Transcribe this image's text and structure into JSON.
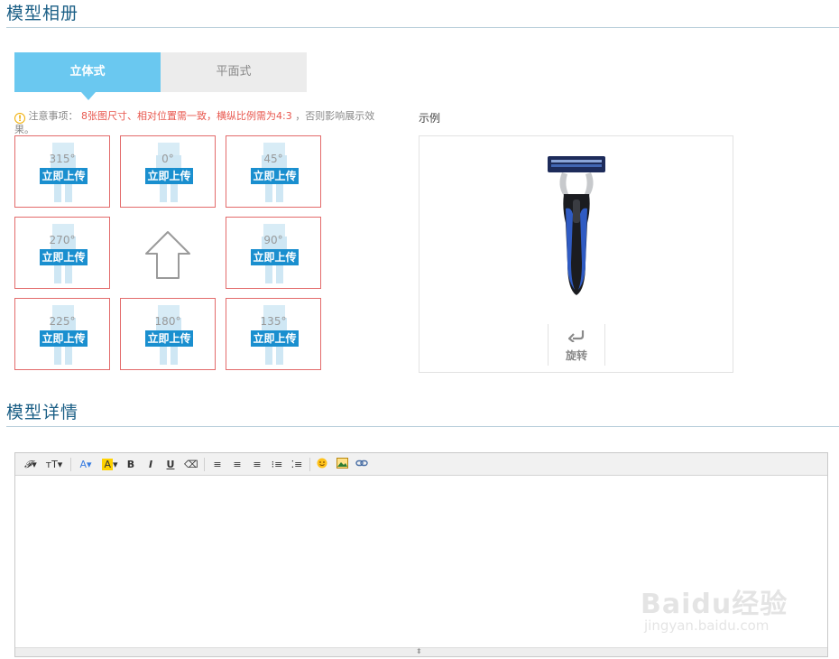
{
  "album": {
    "title": "模型相册",
    "tabs": {
      "active": "立体式",
      "inactive": "平面式"
    },
    "notice": {
      "label": "注意事项：",
      "highlight": "8张图尺寸、相对位置需一致，横纵比例需为4:3",
      "suffix": "，否则影响展示效果。"
    },
    "upload_label": "立即上传",
    "cells": [
      {
        "angle": "315°"
      },
      {
        "angle": "0°"
      },
      {
        "angle": "45°"
      },
      {
        "angle": "270°"
      },
      {
        "angle": "90°"
      },
      {
        "angle": "225°"
      },
      {
        "angle": "180°"
      },
      {
        "angle": "135°"
      }
    ]
  },
  "example": {
    "label": "示例",
    "rotate_label": "旋转"
  },
  "details": {
    "title": "模型详情"
  },
  "editor": {
    "toolbar": [
      "font-family",
      "font-size",
      "font-color",
      "highlight-color",
      "bold",
      "italic",
      "underline",
      "eraser",
      "align-left",
      "align-center",
      "align-right",
      "ordered-list",
      "unordered-list",
      "emoji",
      "image",
      "link"
    ]
  },
  "watermark": {
    "main": "Baidu经验",
    "sub": "jingyan.baidu.com"
  },
  "colors": {
    "tab_active": "#6ac8f0",
    "upload_button": "#1a8fcf",
    "cell_border": "#e36b6b",
    "notice_highlight": "#e8574e",
    "title": "#1b5f86"
  }
}
